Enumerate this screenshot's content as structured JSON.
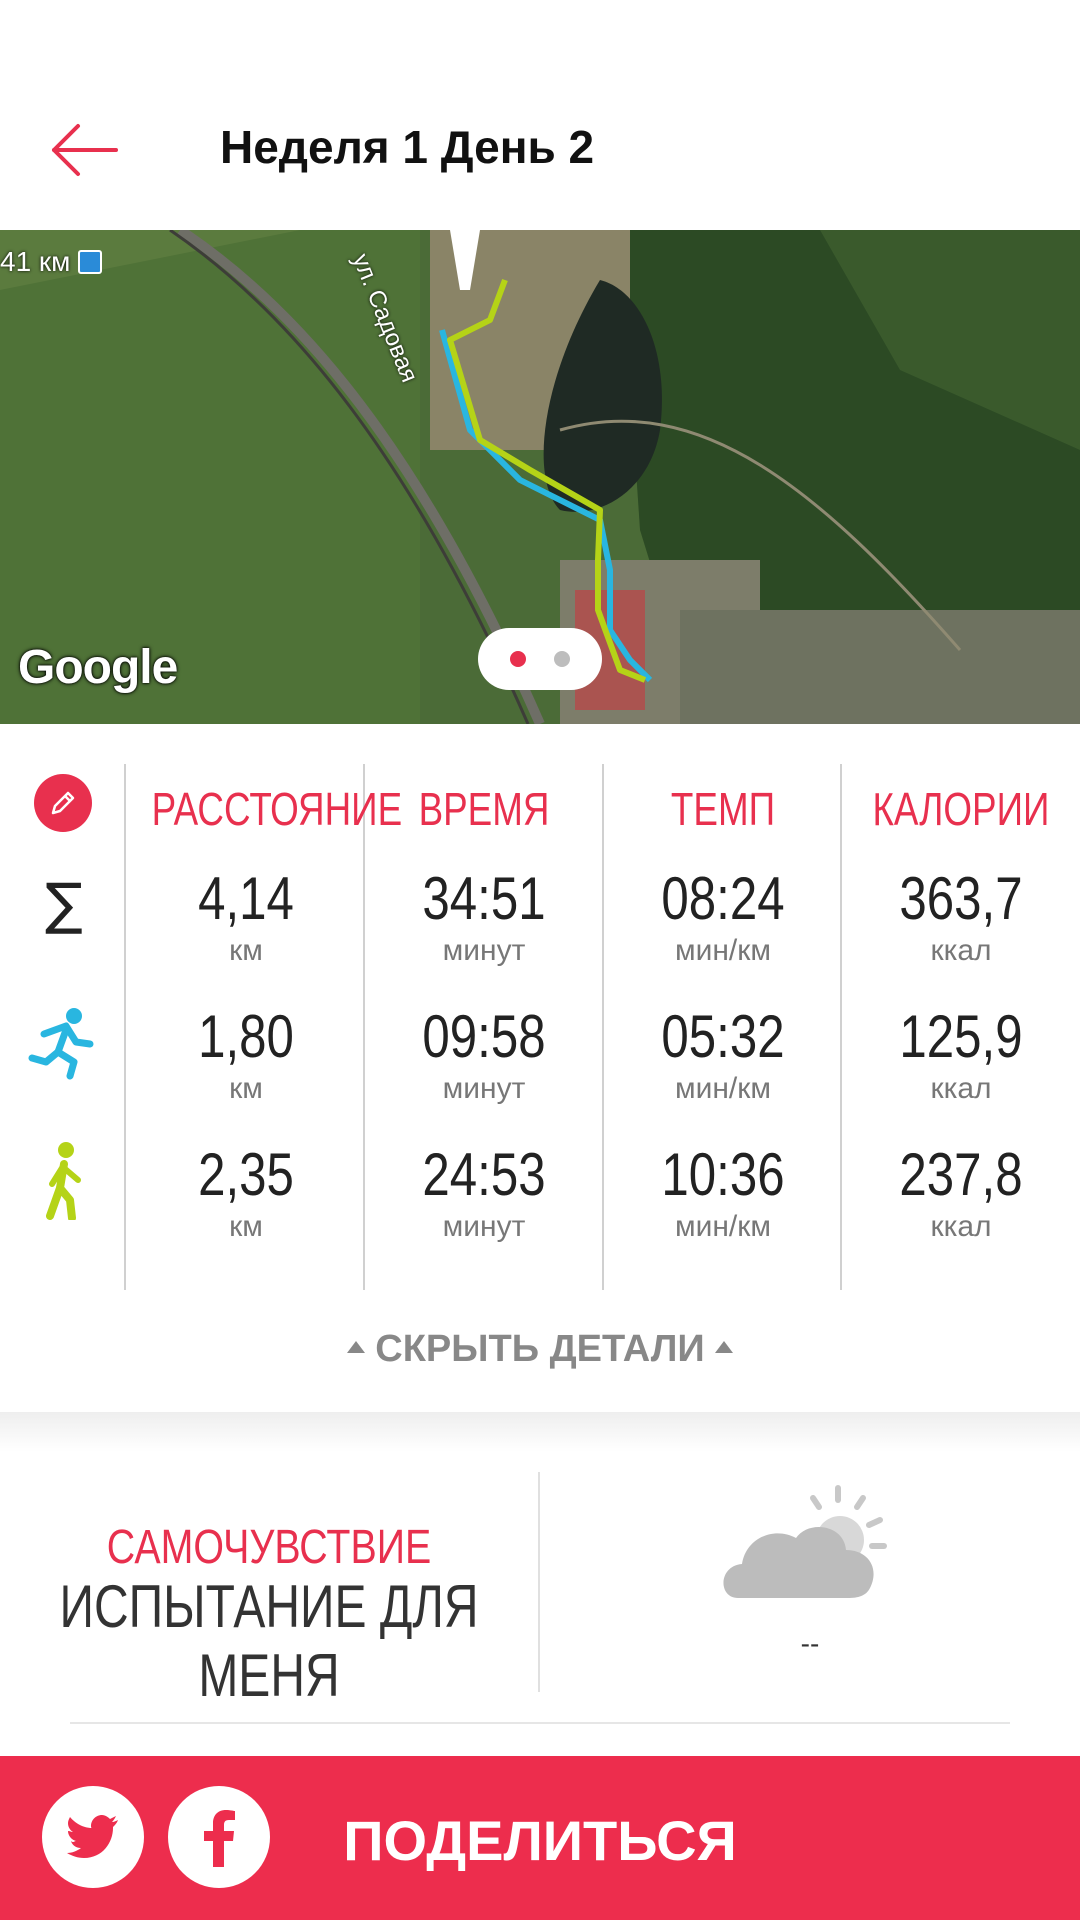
{
  "header": {
    "title": "Неделя 1 День 2"
  },
  "map": {
    "distance_label": "41 км",
    "street_label": "ул. Садовая",
    "provider_label": "Google",
    "pager": {
      "pages": 2,
      "active": 1
    }
  },
  "stats": {
    "columns": [
      "РАССТОЯНИЕ",
      "ВРЕМЯ",
      "ТЕМП",
      "КАЛОРИИ"
    ],
    "rows": [
      {
        "icon": "sigma-icon",
        "cells": [
          {
            "value": "4,14",
            "unit": "км"
          },
          {
            "value": "34:51",
            "unit": "минут"
          },
          {
            "value": "08:24",
            "unit": "мин/км"
          },
          {
            "value": "363,7",
            "unit": "ккал"
          }
        ]
      },
      {
        "icon": "running-icon",
        "cells": [
          {
            "value": "1,80",
            "unit": "км"
          },
          {
            "value": "09:58",
            "unit": "минут"
          },
          {
            "value": "05:32",
            "unit": "мин/км"
          },
          {
            "value": "125,9",
            "unit": "ккал"
          }
        ]
      },
      {
        "icon": "walking-icon",
        "cells": [
          {
            "value": "2,35",
            "unit": "км"
          },
          {
            "value": "24:53",
            "unit": "минут"
          },
          {
            "value": "10:36",
            "unit": "мин/км"
          },
          {
            "value": "237,8",
            "unit": "ккал"
          }
        ]
      }
    ],
    "hide_details_label": "СКРЫТЬ ДЕТАЛИ"
  },
  "feeling": {
    "label": "САМОЧУВСТВИЕ",
    "value": "ИСПЫТАНИЕ ДЛЯ МЕНЯ"
  },
  "weather": {
    "icon": "partly-cloudy-icon",
    "value": "--"
  },
  "share": {
    "label": "ПОДЕЛИТЬСЯ",
    "twitter_icon": "twitter-icon",
    "facebook_icon": "facebook-icon"
  },
  "colors": {
    "accent": "#e8304e",
    "share_bar": "#ed2d4d",
    "run_color": "#29b6e0",
    "walk_color": "#b5d317"
  }
}
